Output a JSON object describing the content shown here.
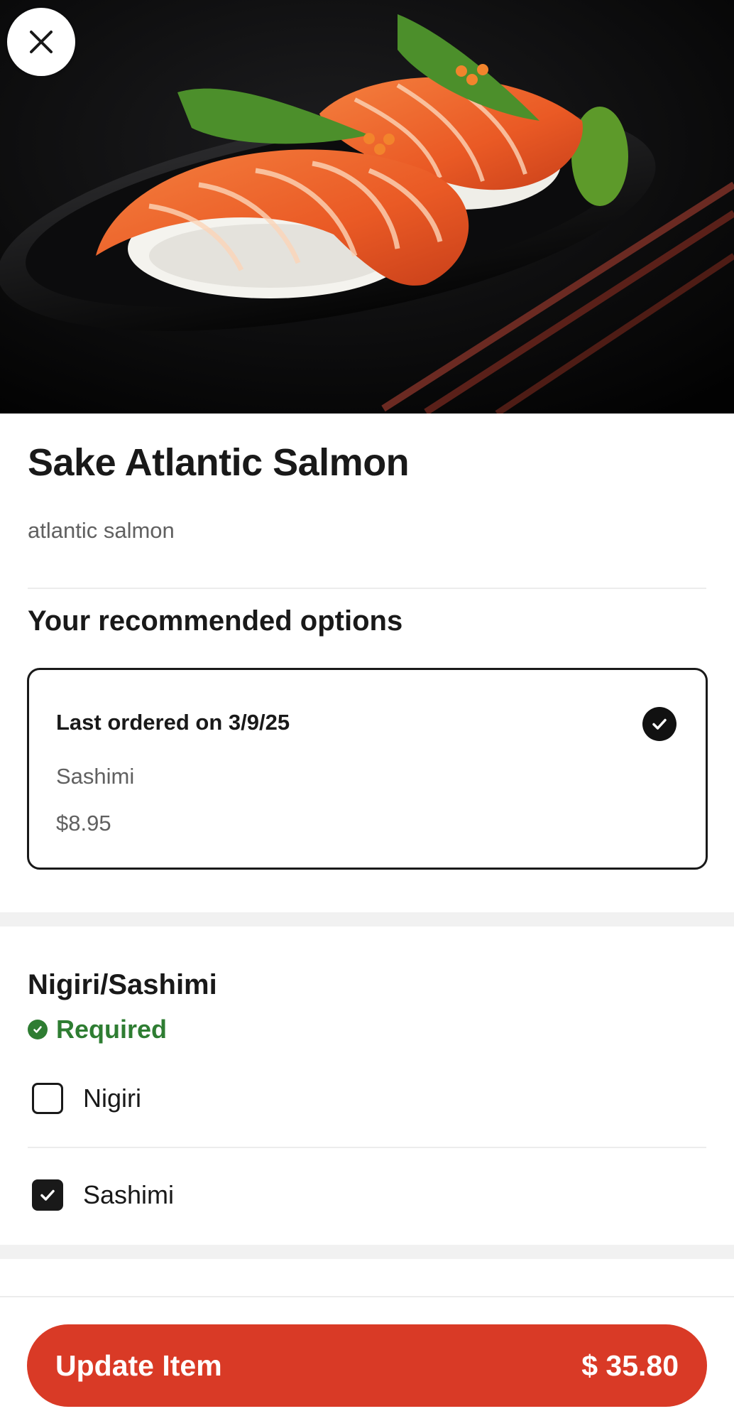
{
  "header": {
    "hero_image": "salmon-nigiri-photo",
    "close_icon": "close-icon"
  },
  "item": {
    "name": "Sake Atlantic Salmon",
    "description": "atlantic salmon"
  },
  "recommended": {
    "heading": "Your recommended options",
    "card": {
      "title": "Last ordered on 3/9/25",
      "option": "Sashimi",
      "price": "$8.95",
      "selected": true
    }
  },
  "choice_group": {
    "heading": "Nigiri/Sashimi",
    "status": "Required",
    "status_color": "#2e7d32",
    "options": [
      {
        "label": "Nigiri",
        "checked": false
      },
      {
        "label": "Sashimi",
        "checked": true
      }
    ]
  },
  "footer": {
    "button_label": "Update Item",
    "button_price": "$ 35.80",
    "button_color": "#d93a26"
  }
}
